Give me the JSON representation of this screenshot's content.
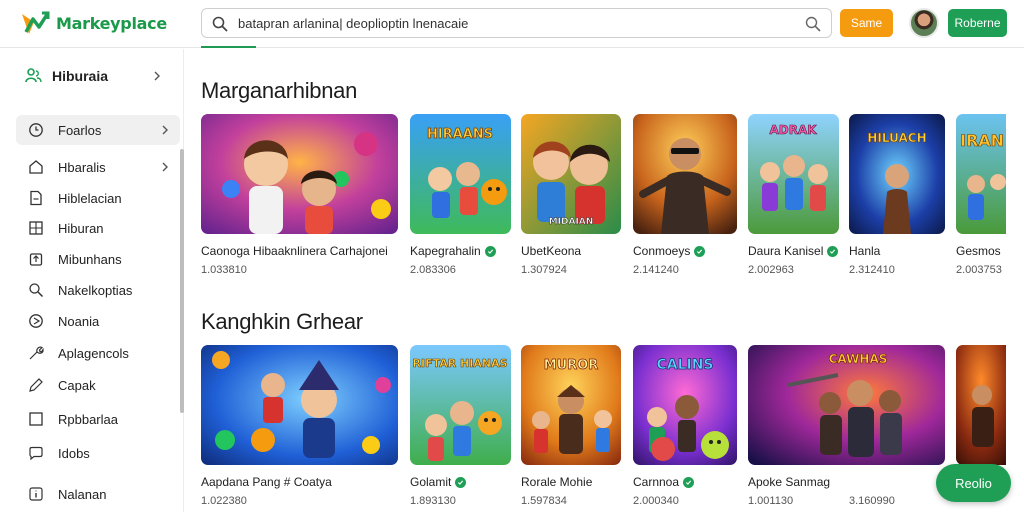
{
  "header": {
    "logo_text": "Markeyplace",
    "search_value": "batapran arlanina| deoplioptin lnenacaie",
    "orange_button": "Same",
    "green_button": "Roberne"
  },
  "sidebar": {
    "top_label": "Hiburaia",
    "items": [
      {
        "label": "Foarlos",
        "icon": "clock-icon"
      },
      {
        "label": "Hbaralis",
        "icon": "home-icon"
      },
      {
        "label": "Hiblelacian",
        "icon": "document-icon"
      },
      {
        "label": "Hiburan",
        "icon": "grid-icon"
      },
      {
        "label": "Mibunhans",
        "icon": "upload-icon"
      },
      {
        "label": "Nakelkoptias",
        "icon": "search-icon"
      },
      {
        "label": "Noania",
        "icon": "compass-icon"
      },
      {
        "label": "Aplagencols",
        "icon": "tool-icon"
      },
      {
        "label": "Capak",
        "icon": "pen-icon"
      },
      {
        "label": "Rpbbarlaa",
        "icon": "square-icon"
      },
      {
        "label": "Idobs",
        "icon": "chat-icon"
      },
      {
        "label": "Nalanan",
        "icon": "info-icon"
      }
    ]
  },
  "sections": [
    {
      "title": "Marganarhibnan",
      "cards": [
        {
          "title": "Caonoga Hibaaknlinera Carhajonei",
          "sub": "1.033810",
          "verified": false
        },
        {
          "title": "Kapegrahalin",
          "sub": "2.083306",
          "verified": true
        },
        {
          "title": "UbetKeona",
          "sub": "1.307924",
          "verified": false
        },
        {
          "title": "Conmoeys",
          "sub": "2.141240",
          "verified": true
        },
        {
          "title": "Daura Kanisel",
          "sub": "2.002963",
          "verified": true
        },
        {
          "title": "Hanla",
          "sub": "2.312410",
          "verified": false
        },
        {
          "title": "Gesmos",
          "sub": "2.003753",
          "verified": false
        }
      ]
    },
    {
      "title": "Kanghkin Grhear",
      "cards": [
        {
          "title": "Aapdana Pang # Coatya",
          "sub": "1.022380",
          "verified": false
        },
        {
          "title": "Golamit",
          "sub": "1.893130",
          "verified": true
        },
        {
          "title": "Rorale Mohie",
          "sub": "1.597834",
          "verified": false
        },
        {
          "title": "Carnnoa",
          "sub": "2.000340",
          "verified": true
        },
        {
          "title": "Apoke Sanmag",
          "sub": "1.001130",
          "verified": false
        },
        {
          "title": "",
          "sub": "3.160990",
          "verified": false
        }
      ]
    }
  ],
  "fab_label": "Reolio",
  "thumb_text": {
    "r1c2": "HIRAANS",
    "r1c3": "MIDAIAN",
    "r1c5": "ADRAK",
    "r1c6": "HILUACH",
    "r1c7": "IRAN",
    "r2c2": "RIFTAR HIANAS",
    "r2c3": "MUROR",
    "r2c4": "CALINS",
    "r2c5": "CAWHAS"
  },
  "colors": {
    "brand_green": "#1e9f55",
    "accent_orange": "#f59b10"
  }
}
